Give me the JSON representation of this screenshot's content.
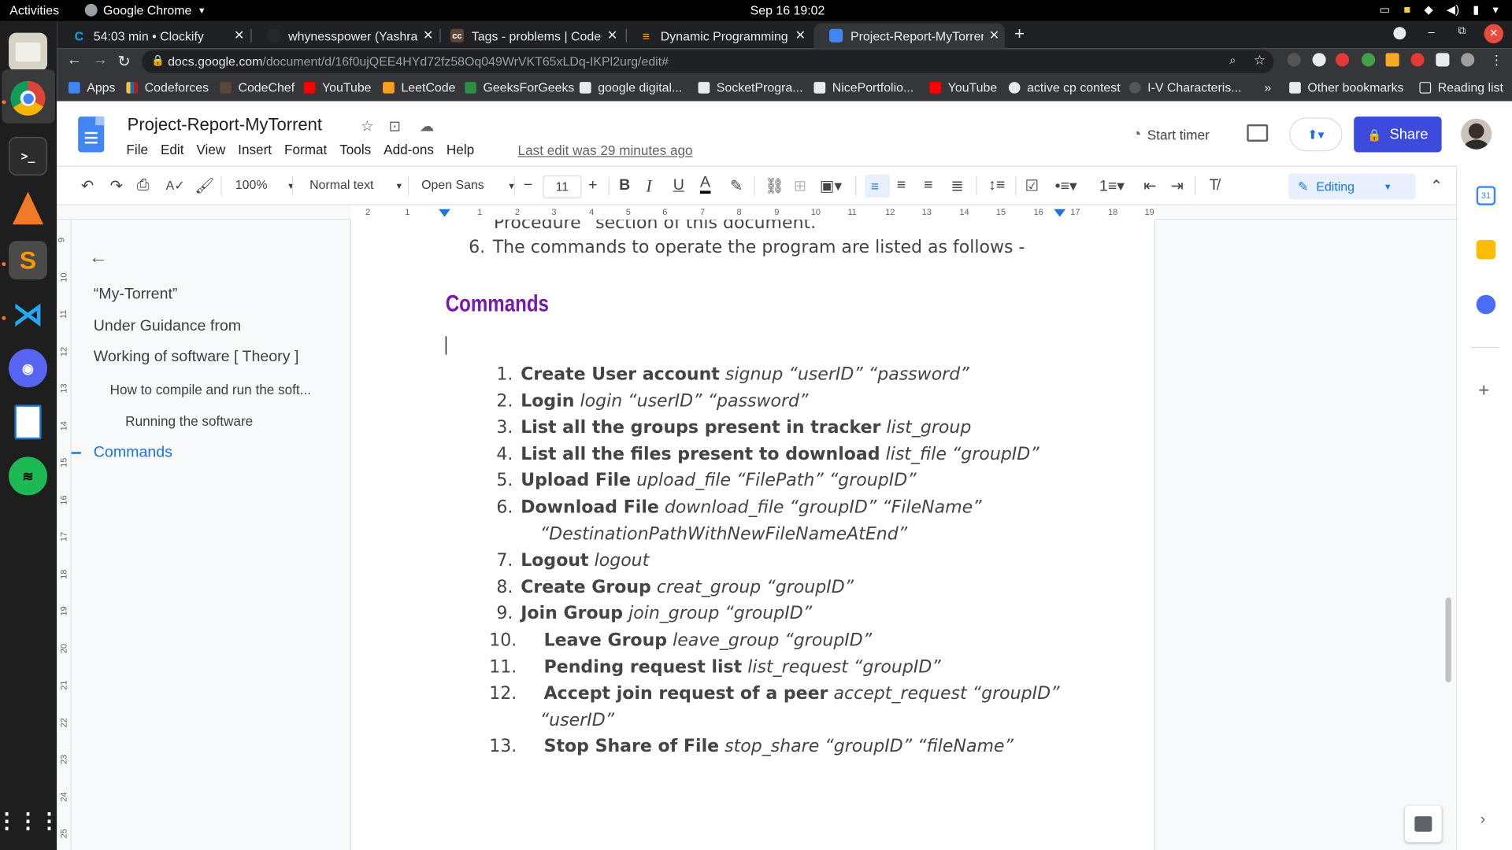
{
  "system": {
    "activities": "Activities",
    "app_name": "Google Chrome",
    "clock": "Sep 16  19:02"
  },
  "tabs": [
    {
      "title": "54:03 min • Clockify",
      "color": "#03a9f4"
    },
    {
      "title": "whynesspower (Yashraj S",
      "color": "#24292e"
    },
    {
      "title": "Tags - problems | CodeCh",
      "color": "#5b4638"
    },
    {
      "title": "Dynamic Programming - S",
      "color": "#f89f1b"
    },
    {
      "title": "Project-Report-MyTorrent",
      "color": "#4285f4"
    }
  ],
  "omnibox": {
    "host": "docs.google.com",
    "path": "/document/d/16f0ujQEE4HYd72fz58Oq049WrVKT65xLDq-IKPl2urg/edit#"
  },
  "bookmarks": [
    {
      "label": "Apps"
    },
    {
      "label": "Codeforces"
    },
    {
      "label": "CodeChef"
    },
    {
      "label": "YouTube"
    },
    {
      "label": "LeetCode"
    },
    {
      "label": "GeeksForGeeks"
    },
    {
      "label": "google digital..."
    },
    {
      "label": "SocketProgra..."
    },
    {
      "label": "NicePortfolio..."
    },
    {
      "label": "YouTube"
    },
    {
      "label": "active cp contest"
    },
    {
      "label": "I-V Characteris..."
    }
  ],
  "bookmarks_more": "»",
  "other_bookmarks": "Other bookmarks",
  "reading_list": "Reading list",
  "doc": {
    "title": "Project-Report-MyTorrent",
    "menus": [
      "File",
      "Edit",
      "View",
      "Insert",
      "Format",
      "Tools",
      "Add-ons",
      "Help"
    ],
    "last_edit": "Last edit was 29 minutes ago",
    "start_timer": "Start timer",
    "share": "Share"
  },
  "toolbar": {
    "zoom": "100%",
    "style": "Normal text",
    "font": "Open Sans",
    "font_size": "11",
    "mode": "Editing"
  },
  "ruler_ticks": [
    "2",
    "1",
    "1",
    "2",
    "3",
    "4",
    "5",
    "6",
    "7",
    "8",
    "9",
    "10",
    "11",
    "12",
    "13",
    "14",
    "15",
    "16",
    "17",
    "18",
    "19"
  ],
  "vruler_ticks": [
    "9",
    "10",
    "11",
    "12",
    "13",
    "14",
    "15",
    "16",
    "17",
    "18",
    "19",
    "20",
    "21",
    "22",
    "23",
    "24",
    "25"
  ],
  "outline": [
    {
      "text": "“My-Torrent”",
      "level": 1
    },
    {
      "text": "Under Guidance from",
      "level": 1
    },
    {
      "text": "Working of software [ Theory ]",
      "level": 1
    },
    {
      "text": "How to compile and run the soft...",
      "level": 2
    },
    {
      "text": "Running the software",
      "level": 3
    },
    {
      "text": "Commands",
      "level": 1,
      "active": true
    }
  ],
  "content": {
    "partial_line": "Procedure” section of this document.",
    "item6_num": "6.",
    "item6_text": "The commands to operate the program are listed as follows -",
    "heading": "Commands",
    "commands": [
      {
        "num": "1.",
        "bold": "Create User account",
        "cmd": "signup “userID” “password”"
      },
      {
        "num": "2.",
        "bold": "Login",
        "cmd": "login “userID” “password”"
      },
      {
        "num": "3.",
        "bold": "List all the groups present in tracker",
        "cmd": "list_group"
      },
      {
        "num": "4.",
        "bold": "List all the files present to download",
        "cmd": "list_file “groupID”"
      },
      {
        "num": "5.",
        "bold": "Upload File",
        "cmd": "upload_file “FilePath” “groupID”"
      },
      {
        "num": "6.",
        "bold": "Download File",
        "cmd": "download_file “groupID” “FileName”",
        "cont": "“DestinationPathWithNewFileNameAtEnd”"
      },
      {
        "num": "7.",
        "bold": "Logout",
        "cmd": "logout"
      },
      {
        "num": "8.",
        "bold": "Create Group",
        "cmd": "creat_group “groupID”"
      },
      {
        "num": "9.",
        "bold": "Join Group",
        "cmd": "join_group “groupID”"
      },
      {
        "num": "10.",
        "bold": "Leave Group",
        "cmd": "leave_group “groupID”"
      },
      {
        "num": "11.",
        "bold": "Pending request list",
        "cmd": "list_request “groupID”"
      },
      {
        "num": "12.",
        "bold": "Accept join request of a peer",
        "cmd": "accept_request “groupID”",
        "cont": "“userID”"
      },
      {
        "num": "13.",
        "bold": "Stop Share of File",
        "cmd": "stop_share “groupID” “fileName”"
      }
    ]
  },
  "colors": {
    "heading": "#7719aa",
    "accent": "#1a73e8",
    "share": "#3c4bdc"
  }
}
